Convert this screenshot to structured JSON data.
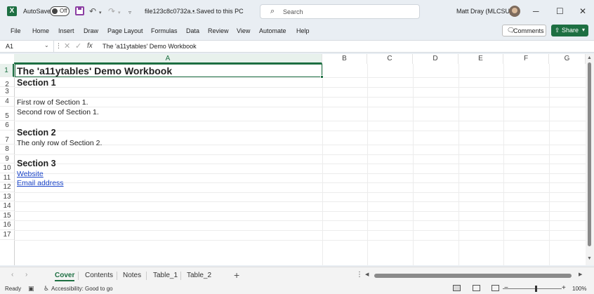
{
  "titlebar": {
    "logo_letter": "X",
    "autosave_label": "AutoSave",
    "autosave_state": "Off",
    "filename": "file123c8c0732a...",
    "save_status": "• Saved to this PC",
    "search_placeholder": "Search",
    "user_name": "Matt Dray (MLCSU)",
    "icons": [
      "save-icon",
      "undo-icon",
      "redo-icon",
      "customize-icon",
      "search-icon",
      "minimize-icon",
      "maximize-icon",
      "close-icon"
    ]
  },
  "menu": {
    "items": [
      "File",
      "Home",
      "Insert",
      "Draw",
      "Page Layout",
      "Formulas",
      "Data",
      "Review",
      "View",
      "Automate",
      "Help"
    ],
    "comments_label": "Comments",
    "share_label": "Share"
  },
  "formula_bar": {
    "name_box": "A1",
    "fx": "fx",
    "content": "The 'a11ytables' Demo Workbook"
  },
  "grid": {
    "columns": [
      "A",
      "B",
      "C",
      "D",
      "E",
      "F",
      "G"
    ],
    "selected_column": "A",
    "rows": [
      "1",
      "2",
      "3",
      "4",
      "5",
      "6",
      "7",
      "8",
      "9",
      "10",
      "11",
      "12",
      "13",
      "14",
      "15",
      "16",
      "17"
    ],
    "selected_row": "1",
    "cells": {
      "A1": "The 'a11ytables' Demo Workbook",
      "A2": "Section 1",
      "A3": "First row of Section 1.",
      "A4": "Second row of Section 1.",
      "A5": "Section 2",
      "A6": "The only row of Section 2.",
      "A7": "Section 3",
      "A8": "Website",
      "A9": "Email address"
    },
    "link_color": "#1b45c9"
  },
  "sheets": {
    "tabs": [
      "Cover",
      "Contents",
      "Notes",
      "Table_1",
      "Table_2"
    ],
    "active": "Cover",
    "add_label": "+"
  },
  "status": {
    "ready": "Ready",
    "accessibility": "Accessibility: Good to go",
    "zoom": "100%",
    "zoom_minus": "−",
    "zoom_plus": "+"
  },
  "accent_color": "#1d6f42"
}
